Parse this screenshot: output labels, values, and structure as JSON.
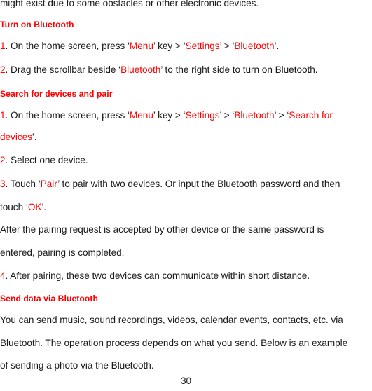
{
  "document": {
    "page_number": "30",
    "accent_color": "#ff0000",
    "text_color": "#1a1a1a",
    "background_color": "#ffffff"
  },
  "intro": {
    "line1": "might exist due to some obstacles or other electronic devices."
  },
  "sections": [
    {
      "heading": "Turn on Bluetooth",
      "steps": [
        {
          "marker": "1",
          "marker_suffix": ".",
          "parts": [
            {
              "text": " On the home screen, press ‘",
              "color": "black"
            },
            {
              "text": "Menu",
              "color": "red"
            },
            {
              "text": "’ key > ‘",
              "color": "black"
            },
            {
              "text": "Settings",
              "color": "red"
            },
            {
              "text": "’ > ‘",
              "color": "black"
            },
            {
              "text": "Bluetooth",
              "color": "red"
            },
            {
              "text": "’.",
              "color": "black"
            }
          ]
        },
        {
          "marker": "2",
          "marker_suffix": ".",
          "parts": [
            {
              "text": " Drag the scrollbar beside ‘",
              "color": "black"
            },
            {
              "text": "Bluetooth",
              "color": "red"
            },
            {
              "text": "’ to the right side to turn on Bluetooth.",
              "color": "black"
            }
          ]
        }
      ]
    },
    {
      "heading": "Search for devices and pair",
      "steps": [
        {
          "marker": "1",
          "marker_suffix": ".",
          "parts": [
            {
              "text": " On the home screen, press ‘",
              "color": "black"
            },
            {
              "text": "Menu",
              "color": "red"
            },
            {
              "text": "’ key > ‘",
              "color": "black"
            },
            {
              "text": "Settings",
              "color": "red"
            },
            {
              "text": "’ > ‘",
              "color": "black"
            },
            {
              "text": "Bluetooth",
              "color": "red"
            },
            {
              "text": "’ > ‘",
              "color": "black"
            },
            {
              "text": "Search for",
              "color": "red"
            }
          ],
          "continuation": [
            {
              "text": "devices",
              "color": "red"
            },
            {
              "text": "’.",
              "color": "black"
            }
          ]
        },
        {
          "marker": "2",
          "marker_suffix": ".",
          "parts": [
            {
              "text": " Select one device.",
              "color": "black"
            }
          ]
        },
        {
          "marker": "3",
          "marker_suffix": ".",
          "parts": [
            {
              "text": " Touch ‘",
              "color": "black"
            },
            {
              "text": "Pair",
              "color": "red"
            },
            {
              "text": "’ to pair with two devices. Or input the Bluetooth password and then",
              "color": "black"
            }
          ],
          "continuation": [
            {
              "text": "touch ‘",
              "color": "black"
            },
            {
              "text": "OK",
              "color": "red"
            },
            {
              "text": "’.",
              "color": "black"
            }
          ]
        }
      ],
      "paragraph": {
        "line1": "After the pairing request is accepted by other device or the same password is",
        "line2": "entered, pairing is completed."
      },
      "final_step": {
        "marker": "4",
        "marker_suffix": ".",
        "text": " After pairing, these two devices can communicate within short distance."
      }
    },
    {
      "heading": "Send data via Bluetooth",
      "paragraph": {
        "line1": "You can send music, sound recordings, videos, calendar events, contacts, etc. via",
        "line2": "Bluetooth. The operation process depends on what you send. Below is an example",
        "line3": "of sending a photo via the Bluetooth."
      }
    }
  ]
}
